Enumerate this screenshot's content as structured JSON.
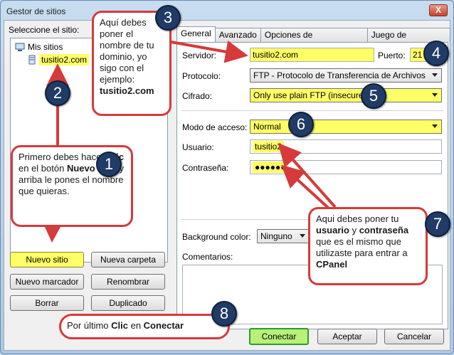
{
  "window": {
    "title": "Gestor de sitios",
    "close_label": "X"
  },
  "sidebar": {
    "label": "Seleccione el sitio:",
    "tree": {
      "root": "Mis sitios",
      "child": "tusitio2.com"
    },
    "buttons": {
      "new_site": "Nuevo sitio",
      "new_folder": "Nueva carpeta",
      "new_bookmark": "Nuevo marcador",
      "rename": "Renombrar",
      "delete": "Borrar",
      "duplicate": "Duplicado"
    }
  },
  "tabs": [
    "General",
    "Avanzado",
    "Opciones de Transferencia",
    "Juego de caracteres"
  ],
  "general": {
    "server_label": "Servidor:",
    "server_value": "tusitio2.com",
    "port_label": "Puerto:",
    "port_value": "21",
    "protocol_label": "Protocolo:",
    "protocol_value": "FTP - Protocolo de Transferencia de Archivos",
    "encryption_label": "Cifrado:",
    "encryption_value": "Only use plain FTP (insecure)",
    "access_label": "Modo de acceso:",
    "access_value": "Normal",
    "user_label": "Usuario:",
    "user_value": "tusitio2",
    "password_label": "Contraseña:",
    "password_value": "●●●●●●",
    "bgcolor_label": "Background color:",
    "bgcolor_value": "Ninguno",
    "comments_label": "Comentarios:"
  },
  "footer": {
    "connect": "Conectar",
    "accept": "Aceptar",
    "cancel": "Cancelar"
  },
  "callouts": {
    "c1": {
      "t1": "Primero debes hacer ",
      "b1": "Clic",
      "t2": " en el botón ",
      "b2": "Nuevo sitio",
      "t3": " y arriba le pones el nombre que quieras."
    },
    "c3": {
      "t1": "Aquí debes poner el nombre de tu dominio, yo sigo con el ejemplo: ",
      "b1": "tusitio2.com"
    },
    "c7": {
      "t1": "Aqui debes poner tu ",
      "b1": "usuario",
      "t2": " y ",
      "b2": "contraseña",
      "t3": " que es el mismo que utilizaste para entrar a ",
      "b3": "CPanel"
    },
    "c8": {
      "t1": "Por último ",
      "b1": "Clic",
      "t2": " en ",
      "b2": "Conectar"
    }
  },
  "badges": [
    "1",
    "2",
    "3",
    "4",
    "5",
    "6",
    "7",
    "8"
  ],
  "colors": {
    "highlight": "#ffff66",
    "badge": "#1f3b66",
    "arrow": "#d63a3a",
    "connect_border": "#2f9a2f"
  }
}
